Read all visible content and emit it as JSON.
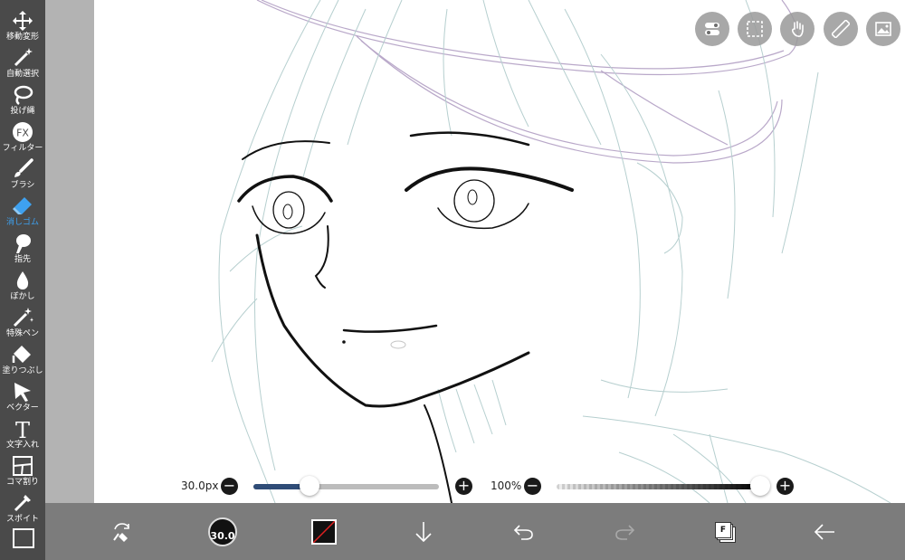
{
  "sidebar": {
    "items": [
      {
        "label": "移動変形",
        "icon": "move-icon"
      },
      {
        "label": "自動選択",
        "icon": "magic-wand-icon"
      },
      {
        "label": "投げ縄",
        "icon": "lasso-icon"
      },
      {
        "label": "フィルター",
        "icon": "fx-icon",
        "glyph": "FX"
      },
      {
        "label": "ブラシ",
        "icon": "brush-icon"
      },
      {
        "label": "消しゴム",
        "icon": "eraser-icon",
        "active": true
      },
      {
        "label": "指先",
        "icon": "finger-icon"
      },
      {
        "label": "ぼかし",
        "icon": "blur-icon"
      },
      {
        "label": "特殊ペン",
        "icon": "special-pen-icon"
      },
      {
        "label": "塗りつぶし",
        "icon": "fill-bucket-icon"
      },
      {
        "label": "ベクター",
        "icon": "vector-icon"
      },
      {
        "label": "文字入れ",
        "icon": "text-icon",
        "glyph": "T"
      },
      {
        "label": "コマ割り",
        "icon": "frame-divider-icon"
      },
      {
        "label": "スポイト",
        "icon": "eyedropper-icon"
      }
    ]
  },
  "top_buttons": [
    "toggle-icon",
    "selection-icon",
    "hand-icon",
    "ruler-icon",
    "image-icon"
  ],
  "brush_size": {
    "label": "30.0px",
    "value": 30.0,
    "fraction": 0.3
  },
  "opacity": {
    "label": "100%",
    "value": 100,
    "fraction": 1.0
  },
  "plus_glyph": "+",
  "minus_glyph": "−",
  "bottom_bar": {
    "brush_size_text": "30.0",
    "layer_letter": "F"
  },
  "colors": {
    "toolbar_bg": "#4a4a4a",
    "active_label": "#3ea1f0",
    "size_fill": "#2f4c77",
    "bottom_bar_bg": "#7c7c7c"
  }
}
